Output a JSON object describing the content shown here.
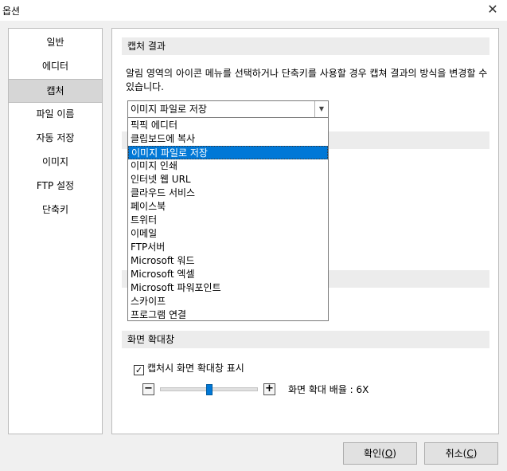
{
  "window": {
    "title": "옵션",
    "close_glyph": "✕"
  },
  "sidebar": {
    "items": [
      {
        "label": "일반"
      },
      {
        "label": "에디터"
      },
      {
        "label": "캡처",
        "selected": true
      },
      {
        "label": "파일 이름"
      },
      {
        "label": "자동 저장"
      },
      {
        "label": "이미지"
      },
      {
        "label": "FTP 설정"
      },
      {
        "label": "단축키"
      }
    ]
  },
  "capture_result": {
    "header": "캡처 결과",
    "description": "알림 영역의 아이콘 메뉴를 선택하거나 단축키를 사용할 경우 캡쳐 결과의 방식을 변경할 수 있습니다.",
    "selected_value": "이미지 파일로 저장",
    "options": [
      "픽픽 에디터",
      "클립보드에 복사",
      "이미지 파일로 저장",
      "이미지 인쇄",
      "인터넷 웹 URL",
      "클라우드 서비스",
      "페이스북",
      "트위터",
      "이메일",
      "FTP서버",
      "Microsoft 워드",
      "Microsoft 엑셀",
      "Microsoft 파워포인트",
      "스카이프",
      "프로그램 연결"
    ],
    "highlighted_index": 2
  },
  "magnifier": {
    "header": "화면 확대창",
    "checkbox_label": "캡처시 화면 확대창 표시",
    "checked": true,
    "minus": "−",
    "plus": "+",
    "zoom_label": "화면 확대 배율 : 6X",
    "slider_fraction": 0.5
  },
  "buttons": {
    "ok": {
      "text": "확인",
      "mnemonic": "O"
    },
    "cancel": {
      "text": "취소",
      "mnemonic": "C"
    }
  },
  "colors": {
    "accent": "#0078d7"
  }
}
